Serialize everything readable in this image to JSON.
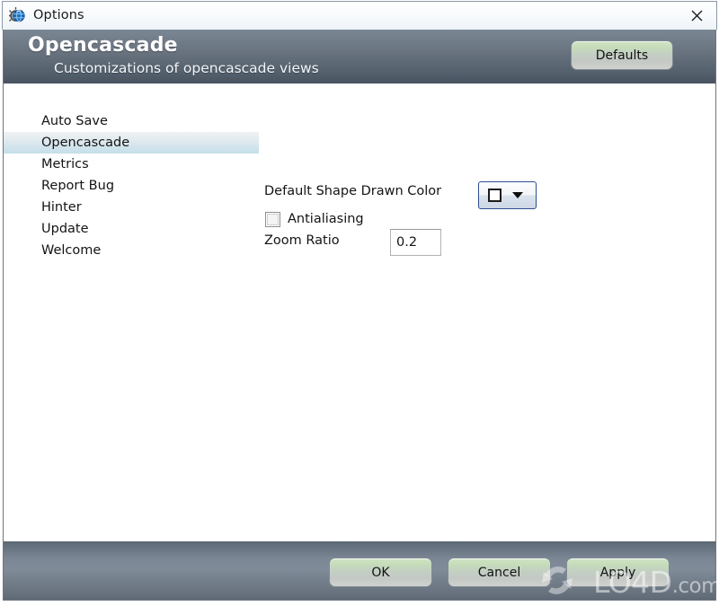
{
  "window": {
    "title": "Options",
    "icon": "opencascade-globe-icon",
    "close_label": "×"
  },
  "header": {
    "title": "Opencascade",
    "subtitle": "Customizations of opencascade views",
    "defaults_label": "Defaults"
  },
  "sidebar": {
    "items": [
      {
        "label": "Auto Save",
        "selected": false
      },
      {
        "label": "Opencascade",
        "selected": true
      },
      {
        "label": "Metrics",
        "selected": false
      },
      {
        "label": "Report Bug",
        "selected": false
      },
      {
        "label": "Hinter",
        "selected": false
      },
      {
        "label": "Update",
        "selected": false
      },
      {
        "label": "Welcome",
        "selected": false
      }
    ]
  },
  "main": {
    "shape_color": {
      "label": "Default Shape Drawn Color",
      "swatch_color": "#ffffff"
    },
    "antialiasing": {
      "label": "Antialiasing",
      "checked": false
    },
    "zoom_ratio": {
      "label": "Zoom Ratio",
      "value": "0.2"
    }
  },
  "footer": {
    "ok_label": "OK",
    "cancel_label": "Cancel",
    "apply_label": "Apply"
  },
  "watermark": {
    "text": "LO4D",
    "suffix": ".com"
  },
  "colors": {
    "header_gradient_top": "#7c8795",
    "header_gradient_bottom": "#49545f",
    "selection_highlight": "#c5dfea",
    "button_green": "#cfe4c5",
    "combo_border_blue": "#2d4f8e"
  }
}
